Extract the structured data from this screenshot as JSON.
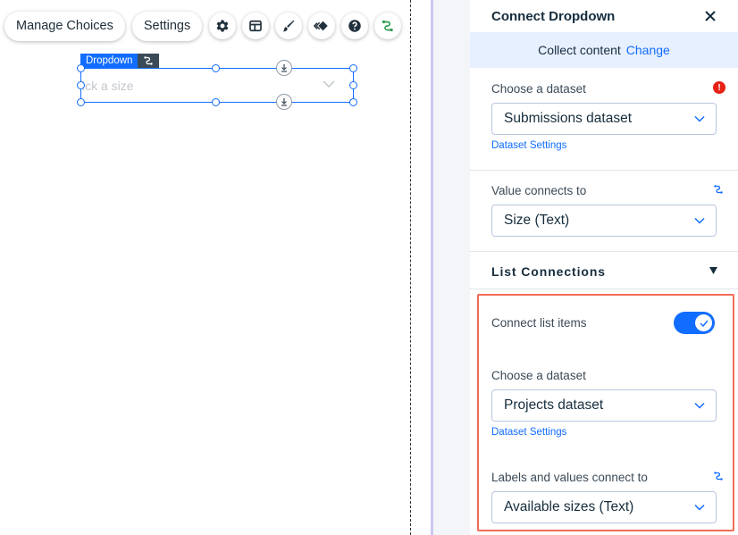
{
  "toolbar": {
    "manage_choices": "Manage Choices",
    "settings": "Settings",
    "icons": [
      "gear-icon",
      "layout-icon",
      "design-brush-icon",
      "animation-icon",
      "help-icon",
      "connect-data-icon"
    ]
  },
  "element": {
    "tag_label": "Dropdown",
    "placeholder": "ick a size"
  },
  "panel": {
    "title": "Connect Dropdown",
    "banner_text": "Collect content",
    "banner_link": "Change",
    "dataset_label": "Choose a dataset",
    "dataset_value": "Submissions dataset",
    "dataset_settings": "Dataset Settings",
    "warning_badge": "!",
    "value_label": "Value connects to",
    "value_value": "Size (Text)",
    "list_section_title": "List Connections",
    "connect_items_label": "Connect list items",
    "connect_items_on": true,
    "list_dataset_label": "Choose a dataset",
    "list_dataset_value": "Projects dataset",
    "list_dataset_settings": "Dataset Settings",
    "labels_label": "Labels and values connect to",
    "labels_value": "Available sizes (Text)"
  },
  "colors": {
    "accent": "#116dff",
    "highlight": "#f16c58",
    "warning": "#e62214",
    "connect_green": "#2e9e4f"
  }
}
